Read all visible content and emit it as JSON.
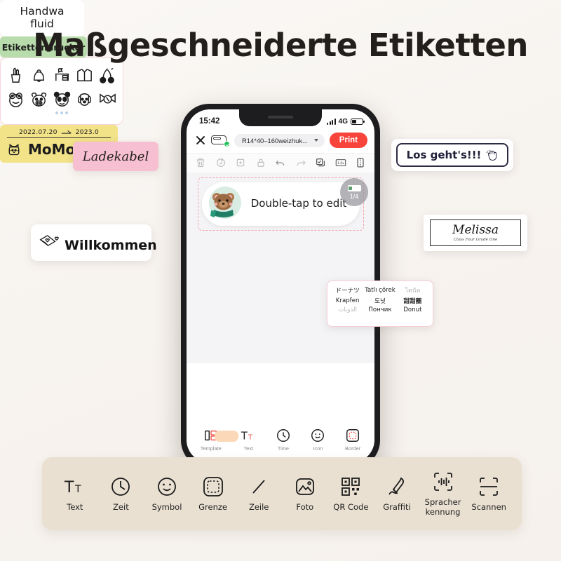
{
  "headline": "Maßgeschneiderte Etiketten",
  "phone": {
    "status_bar": {
      "time": "15:42",
      "network": "4G"
    },
    "header": {
      "close_icon": "close-icon",
      "printer_icon": "printer-connected-icon",
      "label_size": "R14*40–160weizhuk...",
      "print_label": "Print"
    },
    "edit_toolbar": [
      {
        "name": "delete-icon",
        "label": "Delete"
      },
      {
        "name": "rotate-icon",
        "label": "Rotate"
      },
      {
        "name": "duplicate-icon",
        "label": "Duplicate"
      },
      {
        "name": "lock-icon",
        "label": "Lock"
      },
      {
        "name": "undo-icon",
        "label": "Undo"
      },
      {
        "name": "redo-icon",
        "label": "Redo"
      },
      {
        "name": "select-all-icon",
        "label": "Select all"
      },
      {
        "name": "scale-1x-icon",
        "label": "1.0x"
      },
      {
        "name": "mirror-icon",
        "label": "Mirror"
      }
    ],
    "canvas": {
      "label_text": "Double-tap to edit",
      "sticker": "bear-sticker",
      "page_badge": "1/4"
    },
    "nav": [
      {
        "icon": "template-icon",
        "label": "Template"
      },
      {
        "icon": "text-icon",
        "label": "Text"
      },
      {
        "icon": "time-icon",
        "label": "Time"
      },
      {
        "icon": "icon-smiley-icon",
        "label": "Icon"
      },
      {
        "icon": "border-icon",
        "label": "Border"
      }
    ]
  },
  "cards": {
    "ladekabel": {
      "text": "Ladekabel"
    },
    "willkommen": {
      "icon": "envelope-heart-icon",
      "text": "Willkommen"
    },
    "los_gehts": {
      "text": "Los geht's!!!",
      "icon": "hand-icon"
    },
    "melissa": {
      "name": "Melissa",
      "subtitle": "Class Four Grade One"
    },
    "donut": {
      "words": [
        "ドーナツ",
        "Tatlı çörek",
        "โดนัท",
        "Krapfen",
        "도넛",
        "甜甜圈",
        "الدونات",
        "Пончик",
        "Donut"
      ],
      "faint_indices": [
        2,
        6
      ]
    },
    "handwasch": {
      "line1": "Handwa",
      "line2": "fluid"
    },
    "etikettendrucker": {
      "text": "Etikettendrucker"
    },
    "icon_grid": {
      "row1": [
        "pencil-cup-icon",
        "bell-icon",
        "desk-icon",
        "shirt-icon",
        "cherry-icon"
      ],
      "row2": [
        "frog-icon",
        "cow-icon",
        "panda-icon",
        "dog-icon",
        "candy-icon"
      ],
      "pagination_dots": 3
    },
    "momo": {
      "date_from": "2022.07.20",
      "date_to": "2023.0",
      "arrow_icon": "arrow-right-icon",
      "pet_icon": "cat-icon",
      "name": "MoMo"
    }
  },
  "bottom_toolbar": [
    {
      "icon": "text-icon",
      "label": "Text"
    },
    {
      "icon": "clock-icon",
      "label": "Zeit"
    },
    {
      "icon": "smiley-icon",
      "label": "Symbol"
    },
    {
      "icon": "dashed-border-icon",
      "label": "Grenze"
    },
    {
      "icon": "line-icon",
      "label": "Zeile"
    },
    {
      "icon": "photo-icon",
      "label": "Foto"
    },
    {
      "icon": "qr-code-icon",
      "label": "QR Code"
    },
    {
      "icon": "graffiti-pen-icon",
      "label": "Graffiti"
    },
    {
      "icon": "voice-recognition-icon",
      "label": "Spracher kennung"
    },
    {
      "icon": "scan-icon",
      "label": "Scannen"
    }
  ],
  "colors": {
    "background": "#f8f4f0",
    "print_button": "#f8453c",
    "card_pink": "#f7c0d2",
    "card_yellow": "#f2e389",
    "card_green": "#b8dcab",
    "toolbar_strip": "#e9e0d2",
    "status_green": "#25c05a"
  }
}
